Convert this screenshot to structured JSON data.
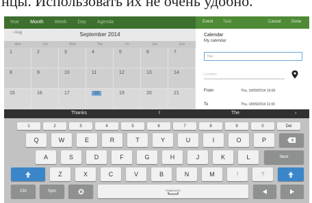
{
  "caption": "нцы. Использовать их не очень удобно.",
  "calendar": {
    "tabs": [
      "Year",
      "Month",
      "Week",
      "Day",
      "Agenda"
    ],
    "prev_label": "Aug",
    "month_title": "September 2014",
    "weekdays": [
      "Mon",
      "Tue",
      "Wed",
      "Thu",
      "Fri",
      "Sat",
      "Sun"
    ],
    "rows": [
      [
        "1",
        "2",
        "3",
        "4",
        "5",
        "6",
        "7"
      ],
      [
        "8",
        "9",
        "10",
        "11",
        "12",
        "13",
        "14"
      ],
      [
        "15",
        "16",
        "17",
        "18",
        "19",
        "20",
        "21"
      ]
    ],
    "today": "18"
  },
  "event": {
    "tab_event": "Event",
    "tab_task": "Task",
    "cancel": "Cancel",
    "done": "Done",
    "calendar_label": "Calendar",
    "calendar_name": "My calendar",
    "title_placeholder": "Title",
    "location_placeholder": "Location",
    "from_label": "From",
    "from_value": "Thu, 18/09/2014  10:00",
    "to_label": "To",
    "to_value": "Thu, 18/09/2014  11:00"
  },
  "suggestions": [
    "Thanks",
    "I",
    "The"
  ],
  "keyboard": {
    "numbers": [
      "1",
      "2",
      "3",
      "4",
      "5",
      "6",
      "7",
      "8",
      "9",
      "0"
    ],
    "row1": [
      "Q",
      "W",
      "E",
      "R",
      "T",
      "Y",
      "U",
      "I",
      "O",
      "P"
    ],
    "row2": [
      "A",
      "S",
      "D",
      "F",
      "G",
      "H",
      "J",
      "K",
      "L"
    ],
    "row3": [
      "Z",
      "X",
      "C",
      "V",
      "B",
      "N",
      "M",
      "!",
      "?"
    ],
    "del": "Del",
    "next": "Next",
    "ctrl": "Ctrl",
    "sym": "Sym",
    "space_label": "English(UK)",
    "accent_color": "#3a86c8"
  }
}
